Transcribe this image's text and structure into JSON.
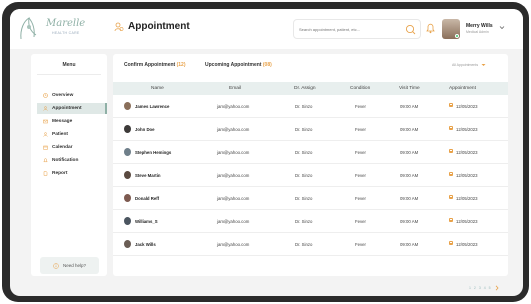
{
  "brand": {
    "name": "Marelle",
    "tagline": "HEALTH CARE",
    "accent": "#8fb0a6",
    "highlight": "#e8a24a"
  },
  "page": {
    "title": "Appointment"
  },
  "search": {
    "placeholder": "Search appointment, patient, etc..."
  },
  "user": {
    "name": "Merry Wills",
    "role": "Medical Admin"
  },
  "sidebar": {
    "heading": "Menu",
    "items": [
      {
        "label": "Overview",
        "icon": "clock-icon",
        "active": false
      },
      {
        "label": "Appointment",
        "icon": "user-icon",
        "active": true
      },
      {
        "label": "Message",
        "icon": "message-icon",
        "active": false
      },
      {
        "label": "Patient",
        "icon": "patient-icon",
        "active": false
      },
      {
        "label": "Calendar",
        "icon": "calendar-icon",
        "active": false
      },
      {
        "label": "Notification",
        "icon": "bell-icon",
        "active": false
      },
      {
        "label": "Report",
        "icon": "report-icon",
        "active": false
      }
    ],
    "help": "Need help?"
  },
  "tabs": {
    "confirm": {
      "label": "Confirm Appointment",
      "count": "(12)"
    },
    "upcoming": {
      "label": "Upcoming Appointment",
      "count": "(08)"
    },
    "filter": "All Appointments"
  },
  "table": {
    "columns": [
      "Name",
      "Email",
      "Dr. Assign",
      "Condition",
      "Visit Time",
      "Appointment"
    ],
    "rows": [
      {
        "name": "James Lawrence",
        "email": "jam@yahoo.com",
        "doctor": "Dr. Sinzo",
        "condition": "Fever",
        "time": "09:00 AM",
        "date": "12/05/2023"
      },
      {
        "name": "John Doe",
        "email": "jam@yahoo.com",
        "doctor": "Dr. Sinzo",
        "condition": "Fever",
        "time": "09:00 AM",
        "date": "12/05/2023"
      },
      {
        "name": "Stephen Hemings",
        "email": "jam@yahoo.com",
        "doctor": "Dr. Sinzo",
        "condition": "Fever",
        "time": "09:00 AM",
        "date": "12/05/2023"
      },
      {
        "name": "Steve Martin",
        "email": "jam@yahoo.com",
        "doctor": "Dr. Sinzo",
        "condition": "Fever",
        "time": "09:00 AM",
        "date": "12/05/2023"
      },
      {
        "name": "Donald Reff",
        "email": "jam@yahoo.com",
        "doctor": "Dr. Sinzo",
        "condition": "Fever",
        "time": "09:00 AM",
        "date": "12/05/2023"
      },
      {
        "name": "Williams_S",
        "email": "jam@yahoo.com",
        "doctor": "Dr. Sinzo",
        "condition": "Fever",
        "time": "09:00 AM",
        "date": "12/05/2023"
      },
      {
        "name": "Jack Wills",
        "email": "jam@yahoo.com",
        "doctor": "Dr. Sinzo",
        "condition": "Fever",
        "time": "09:00 AM",
        "date": "12/05/2023"
      }
    ]
  },
  "pagination": {
    "pages": "1 2 3 4 5"
  }
}
